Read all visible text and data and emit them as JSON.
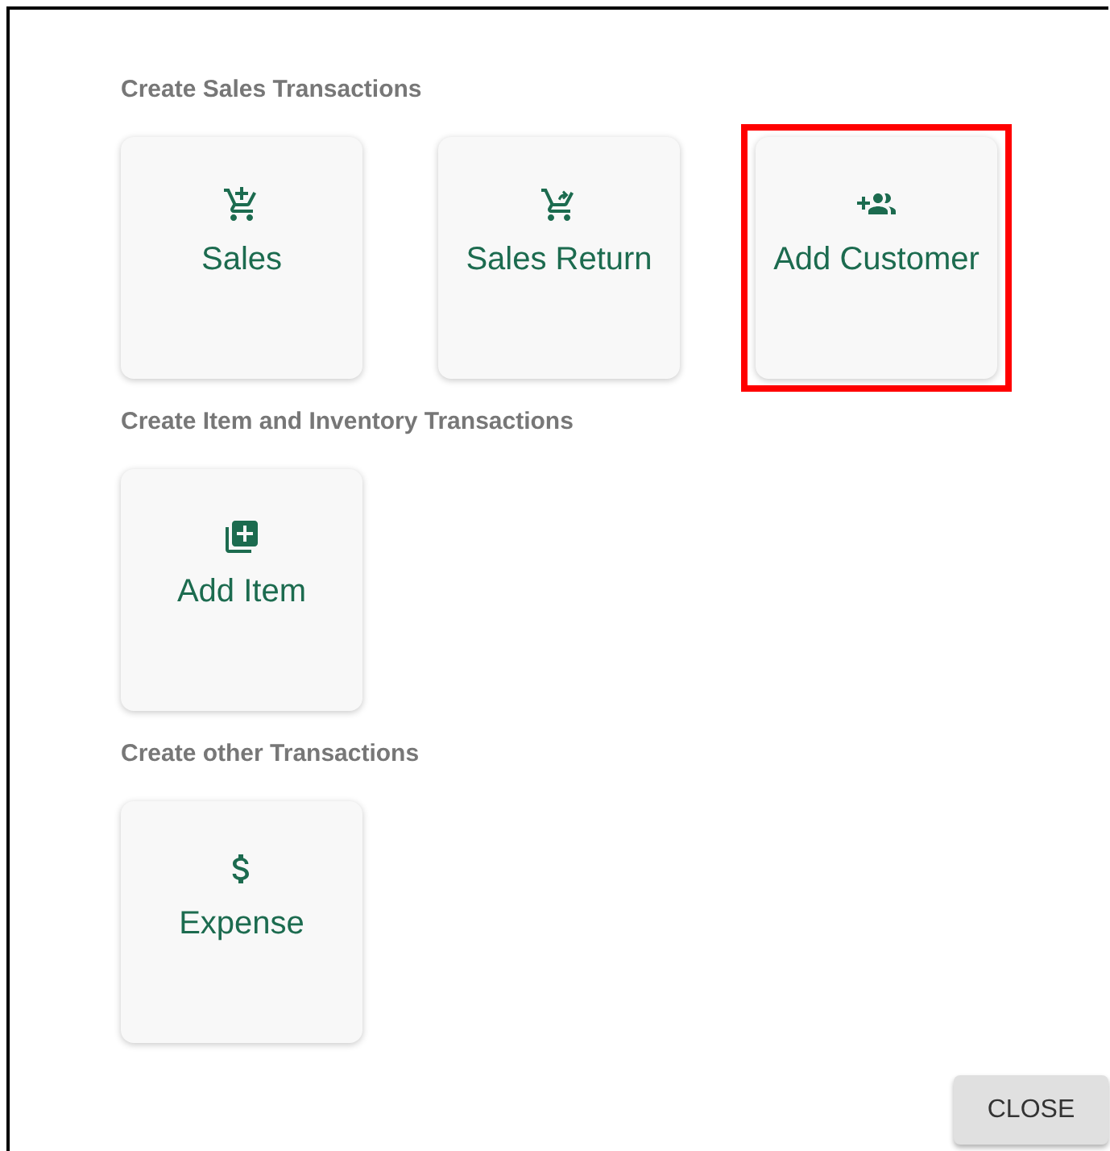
{
  "sections": [
    {
      "title": "Create Sales Transactions",
      "tiles": [
        {
          "label": "Sales",
          "kind": "cart-plus",
          "highlighted": false
        },
        {
          "label": "Sales Return",
          "kind": "cart-return",
          "highlighted": false
        },
        {
          "label": "Add Customer",
          "kind": "group-add",
          "highlighted": true
        }
      ]
    },
    {
      "title": "Create Item and Inventory Transactions",
      "tiles": [
        {
          "label": "Add Item",
          "kind": "library-add",
          "highlighted": false
        }
      ]
    },
    {
      "title": "Create other Transactions",
      "tiles": [
        {
          "label": "Expense",
          "kind": "dollar",
          "highlighted": false
        }
      ]
    }
  ],
  "close_button": "CLOSE"
}
